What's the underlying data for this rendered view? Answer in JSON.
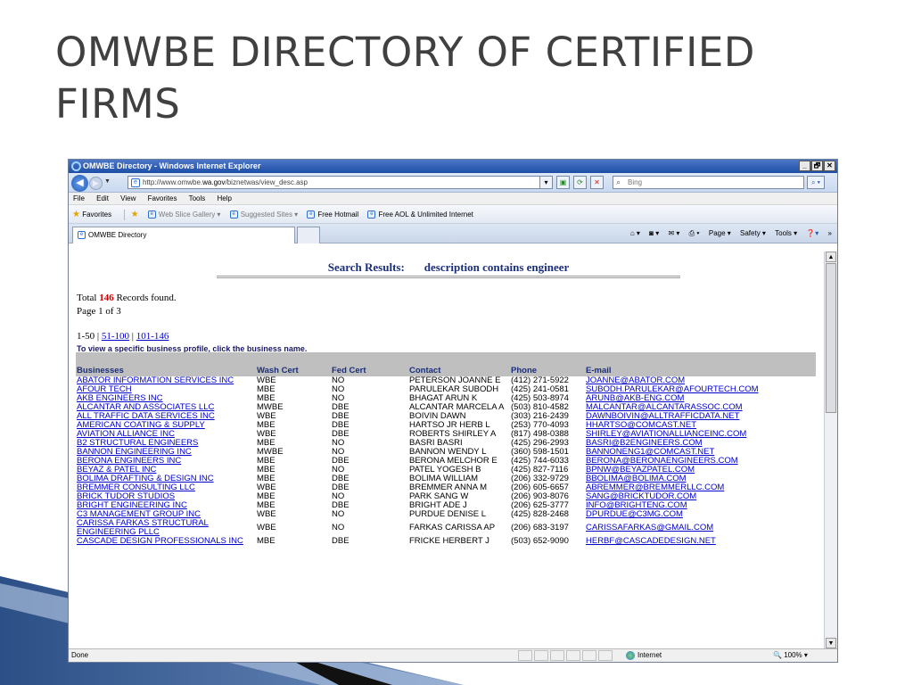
{
  "slide": {
    "title": "OMWBE DIRECTORY OF CERTIFIED FIRMS"
  },
  "window": {
    "title": "OMWBE Directory - Windows Internet Explorer",
    "controls": [
      "_",
      "🗗",
      "✕"
    ]
  },
  "address_bar": {
    "url_prefix": "http://www.omwbe.",
    "url_domain": "wa.gov",
    "url_suffix": "/biznetwas/view_desc.asp",
    "search_placeholder": "Bing"
  },
  "menu": [
    "File",
    "Edit",
    "View",
    "Favorites",
    "Tools",
    "Help"
  ],
  "favorites_bar": {
    "favorites_label": "Favorites",
    "web_slice": "Web Slice Gallery ▾",
    "suggested": "Suggested Sites ▾",
    "hotmail": "Free Hotmail",
    "aol": "Free AOL & Unlimited Internet"
  },
  "tab": {
    "label": "OMWBE Directory"
  },
  "command_bar": {
    "page": "Page ▾",
    "safety": "Safety ▾",
    "tools": "Tools ▾",
    "more": "»"
  },
  "results": {
    "heading_label": "Search Results:",
    "heading_query": "description contains engineer",
    "total_prefix": "Total ",
    "total_count": "146",
    "total_suffix": " Records found.",
    "page_info": "Page 1 of 3",
    "pager_current": "1-50",
    "pager_sep": " | ",
    "pager_link_2": "51-100",
    "pager_link_3": "101-146",
    "hint": "To view a specific business profile, click the business name.",
    "columns": {
      "business": "Businesses",
      "wash": "Wash Cert",
      "fed": "Fed Cert",
      "contact": "Contact",
      "phone": "Phone",
      "email": "E-mail"
    },
    "rows": [
      {
        "business": "ABATOR INFORMATION SERVICES INC",
        "wash": "WBE",
        "fed": "NO",
        "contact": "PETERSON JOANNE E",
        "phone": "(412) 271-5922",
        "email": "JOANNE@ABATOR.COM"
      },
      {
        "business": "AFOUR TECH",
        "wash": "MBE",
        "fed": "NO",
        "contact": "PARULEKAR SUBODH",
        "phone": "(425) 241-0581",
        "email": "SUBODH.PARULEKAR@AFOURTECH.COM"
      },
      {
        "business": "AKB ENGINEERS INC",
        "wash": "MBE",
        "fed": "NO",
        "contact": "BHAGAT ARUN K",
        "phone": "(425) 503-8974",
        "email": "ARUNB@AKB-ENG.COM"
      },
      {
        "business": "ALCANTAR AND ASSOCIATES LLC",
        "wash": "MWBE",
        "fed": "DBE",
        "contact": "ALCANTAR MARCELA A",
        "phone": "(503) 810-4582",
        "email": "MALCANTAR@ALCANTARASSOC.COM"
      },
      {
        "business": "ALL TRAFFIC DATA SERVICES INC",
        "wash": "WBE",
        "fed": "DBE",
        "contact": "BOIVIN DAWN",
        "phone": "(303) 216-2439",
        "email": "DAWNBOIVIN@ALLTRAFFICDATA.NET"
      },
      {
        "business": "AMERICAN COATING & SUPPLY",
        "wash": "MBE",
        "fed": "DBE",
        "contact": "HARTSO JR HERB L",
        "phone": "(253) 770-4093",
        "email": "HHARTSO@COMCAST.NET"
      },
      {
        "business": "AVIATION ALLIANCE INC",
        "wash": "WBE",
        "fed": "DBE",
        "contact": "ROBERTS SHIRLEY A",
        "phone": "(817) 498-0388",
        "email": "SHIRLEY@AVIATIONALLIANCEINC.COM"
      },
      {
        "business": "B2 STRUCTURAL ENGINEERS",
        "wash": "MBE",
        "fed": "NO",
        "contact": "BASRI BASRI",
        "phone": "(425) 296-2993",
        "email": "BASRI@B2ENGINEERS.COM"
      },
      {
        "business": "BANNON ENGINEERING INC",
        "wash": "MWBE",
        "fed": "NO",
        "contact": "BANNON WENDY L",
        "phone": "(360) 598-1501",
        "email": "BANNONENG1@COMCAST.NET"
      },
      {
        "business": "BERONA ENGINEERS INC",
        "wash": "MBE",
        "fed": "DBE",
        "contact": "BERONA MELCHOR E",
        "phone": "(425) 744-6033",
        "email": "BERONA@BERONAENGINEERS.COM"
      },
      {
        "business": "BEYAZ & PATEL INC",
        "wash": "MBE",
        "fed": "NO",
        "contact": "PATEL YOGESH B",
        "phone": "(425) 827-7116",
        "email": "BPNW@BEYAZPATEL.COM"
      },
      {
        "business": "BOLIMA DRAFTING & DESIGN INC",
        "wash": "MBE",
        "fed": "DBE",
        "contact": "BOLIMA WILLIAM",
        "phone": "(206) 332-9729",
        "email": "BBOLIMA@BOLIMA.COM"
      },
      {
        "business": "BREMMER CONSULTING LLC",
        "wash": "WBE",
        "fed": "DBE",
        "contact": "BREMMER ANNA M",
        "phone": "(206) 605-6657",
        "email": "ABREMMER@BREMMERLLC.COM"
      },
      {
        "business": "BRICK TUDOR STUDIOS",
        "wash": "MBE",
        "fed": "NO",
        "contact": "PARK SANG W",
        "phone": "(206) 903-8076",
        "email": "SANG@BRICKTUDOR.COM"
      },
      {
        "business": "BRIGHT ENGINEERING INC",
        "wash": "MBE",
        "fed": "DBE",
        "contact": "BRIGHT ADE J",
        "phone": "(206) 625-3777",
        "email": "INFO@BRIGHTENG.COM"
      },
      {
        "business": "C3 MANAGEMENT GROUP INC",
        "wash": "WBE",
        "fed": "NO",
        "contact": "PURDUE DENISE L",
        "phone": "(425) 828-2468",
        "email": "DPURDUE@C3MG.COM"
      },
      {
        "business": "CARISSA FARKAS STRUCTURAL ENGINEERING PLLC",
        "wash": "WBE",
        "fed": "NO",
        "contact": "FARKAS CARISSA AP",
        "phone": "(206) 683-3197",
        "email": "CARISSAFARKAS@GMAIL.COM"
      },
      {
        "business": "CASCADE DESIGN PROFESSIONALS INC",
        "wash": "MBE",
        "fed": "DBE",
        "contact": "FRICKE HERBERT J",
        "phone": "(503) 652-9090",
        "email": "HERBF@CASCADEDESIGN.NET"
      }
    ]
  },
  "status_bar": {
    "status": "Done",
    "zone": "Internet",
    "zoom": "100% ▾"
  },
  "colors": {
    "heading_navy": "#1b2e7a",
    "count_red": "#cc0000",
    "link_blue": "#0000cc",
    "header_gray": "#bfbfbf",
    "title_gray": "#404040"
  }
}
